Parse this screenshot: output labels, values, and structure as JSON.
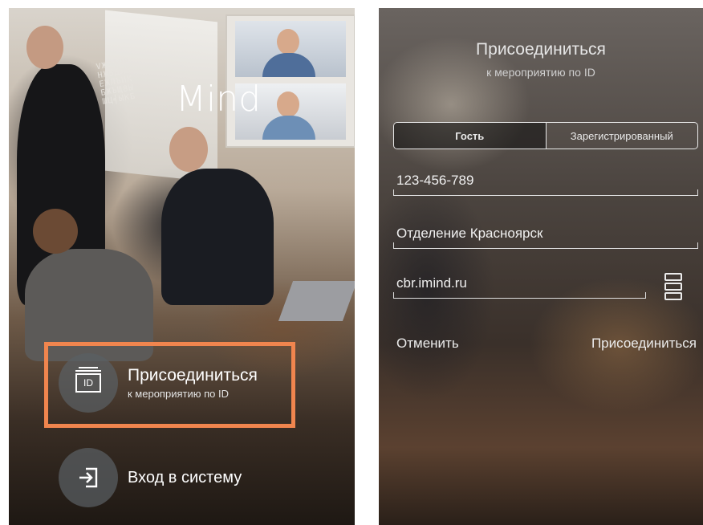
{
  "left_screen": {
    "logo_glyphs": "VЖZ╪ЯВ\nНЖ5ДЯЗ\nЕЖЛЪИК\nБЖЪЩ8Ы\nШЦ╡ЫКБ",
    "logo_text": "Mind",
    "join_action": {
      "title": "Присоединиться",
      "subtitle": "к мероприятию по ID",
      "icon_text": "ID"
    },
    "login_action": {
      "title": "Вход в систему"
    }
  },
  "right_screen": {
    "title": "Присоединиться",
    "subtitle": "к мероприятию по ID",
    "tabs": [
      {
        "label": "Гость",
        "active": true
      },
      {
        "label": "Зарегистрированный",
        "active": false
      }
    ],
    "fields": {
      "conference_id": "123-456-789",
      "name": "Отделение Красноярск",
      "server": "cbr.imind.ru"
    },
    "cancel_label": "Отменить",
    "join_label": "Присоединиться"
  },
  "colors": {
    "highlight": "#f0854e",
    "text": "#ffffff"
  }
}
